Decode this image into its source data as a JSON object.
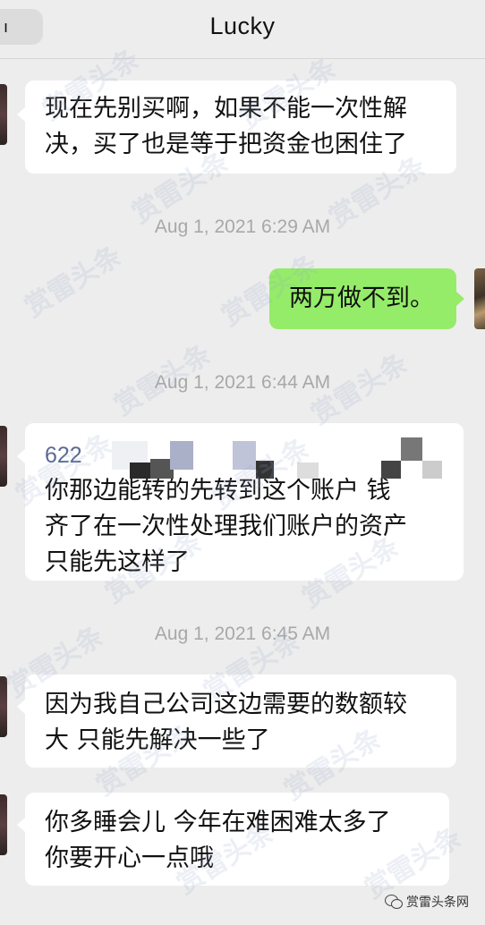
{
  "header": {
    "title": "Lucky",
    "back_label": "ı"
  },
  "messages": [
    {
      "lines": [
        "现在先别买啊，如果不能一次性解",
        "决，买了也是等于把资金也困住了"
      ]
    },
    {
      "timestamp": "Aug 1, 2021 6:29 AM"
    },
    {
      "mine": true,
      "lines": [
        "两万做不到。"
      ]
    },
    {
      "timestamp": "Aug 1, 2021 6:44 AM"
    },
    {
      "account_prefix": "622",
      "lines": [
        "你那边能转的先转到这个账户 钱",
        "齐了在一次性处理我们账户的资产",
        "只能先这样了"
      ]
    },
    {
      "timestamp": "Aug 1, 2021 6:45 AM"
    },
    {
      "lines": [
        "因为我自己公司这边需要的数额较",
        "大 只能先解决一些了"
      ]
    },
    {
      "lines": [
        "你多睡会儿 今年在难困难太多了",
        "你要开心一点哦"
      ]
    }
  ],
  "watermark": {
    "text": "赏雷头条",
    "corner_text": "赏雷头条网"
  },
  "colors": {
    "background": "#ededed",
    "bubble_other": "#ffffff",
    "bubble_mine": "#95ec69",
    "timestamp": "#a8a8a8"
  }
}
